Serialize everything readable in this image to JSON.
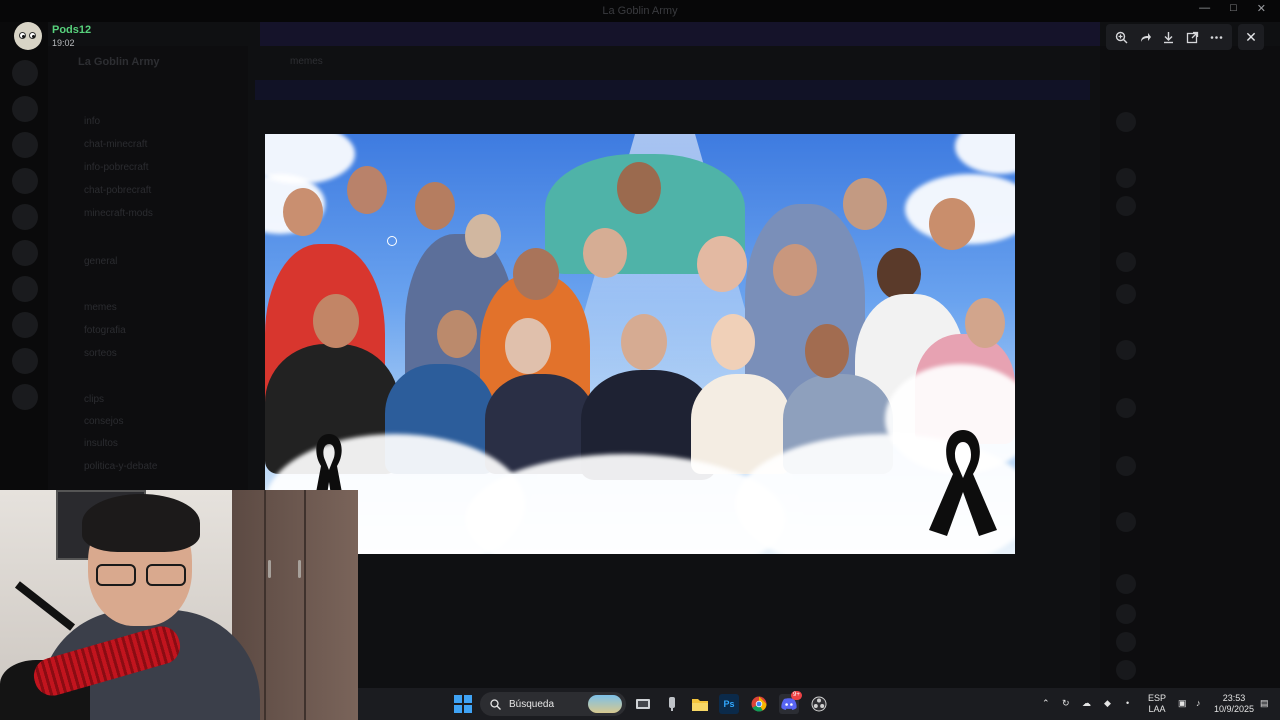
{
  "window": {
    "title": "La Goblin Army"
  },
  "viewer": {
    "user_name": "Pods12",
    "timestamp": "19:02",
    "tools": [
      {
        "icon": "zoom-in-icon"
      },
      {
        "icon": "forward-icon"
      },
      {
        "icon": "download-icon"
      },
      {
        "icon": "open-external-icon"
      },
      {
        "icon": "more-icon"
      }
    ],
    "close_icon": "close-icon"
  },
  "background": {
    "server_name": "La Goblin Army",
    "channel_header": "memes",
    "channels": [
      "info",
      "chat-minecraft",
      "info-pobrecraft",
      "chat-pobrecraft",
      "minecraft-mods",
      "general",
      "memes",
      "fotografia",
      "sorteos",
      "clips",
      "consejos",
      "insultos",
      "politica-y-debate"
    ]
  },
  "taskbar": {
    "search_label": "Búsqueda",
    "apps": [
      {
        "name": "windows-start-icon"
      },
      {
        "name": "task-view-icon"
      },
      {
        "name": "voice-recorder-icon"
      },
      {
        "name": "file-explorer-icon"
      },
      {
        "name": "photoshop-icon",
        "label": "Ps"
      },
      {
        "name": "chrome-icon"
      },
      {
        "name": "discord-icon",
        "badge": "9+"
      },
      {
        "name": "obs-icon"
      }
    ],
    "language_top": "ESP",
    "language_bottom": "LAA",
    "time": "23:53",
    "date": "10/9/2025"
  },
  "colors": {
    "username_green": "#57d17c",
    "accent_blue": "#3fa3f5",
    "taskbar_bg": "#1b1c20"
  }
}
